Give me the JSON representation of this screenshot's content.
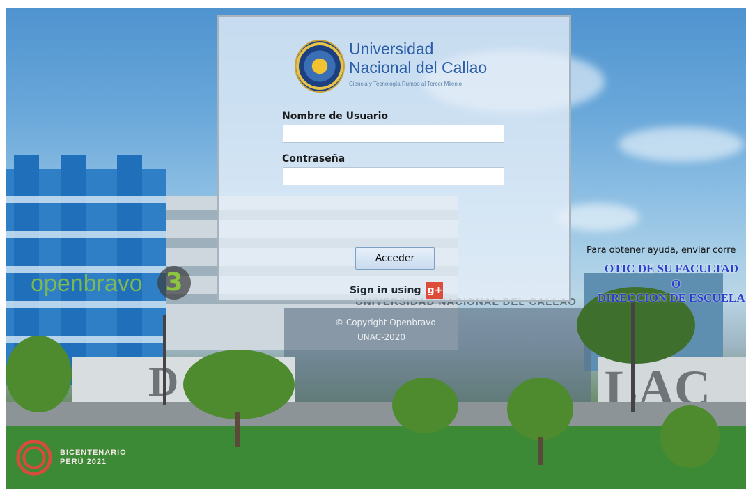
{
  "login": {
    "university_name_line1": "Universidad",
    "university_name_line2": "Nacional del Callao",
    "university_motto": "Ciencia y Tecnología Rumbo al Tercer Milenio",
    "username_label": "Nombre de Usuario",
    "username_value": "",
    "password_label": "Contraseña",
    "password_value": "",
    "submit_label": "Acceder",
    "signin_label": "Sign in using",
    "gplus_label": "g+"
  },
  "background": {
    "help_text": "Para obtener ayuda, enviar corre",
    "faculty_line1": "OTIC DE SU FACULTAD",
    "faculty_line2": "O",
    "faculty_line3": "DIRECCION DE ESCUELA",
    "gate_sign": "UNIVERSIDAD NACIONAL DEL CALLAO",
    "copyright": "© Copyright Openbravo",
    "copyright_year": "UNAC-2020",
    "openbravo_logo": "openbravo",
    "openbravo_version": "3",
    "bicentenario_line1": "BICENTENARIO",
    "bicentenario_line2": "PERÚ 2021"
  },
  "colors": {
    "accent_blue": "#2b5ea7",
    "faculty_text": "#2a3fcf",
    "gplus_red": "#dd4b39",
    "openbravo_green": "#8bc53f"
  },
  "icons": {
    "university_seal": "university-seal-icon",
    "gplus": "gplus-icon",
    "bicentenario": "bicentenario-emblem-icon"
  }
}
